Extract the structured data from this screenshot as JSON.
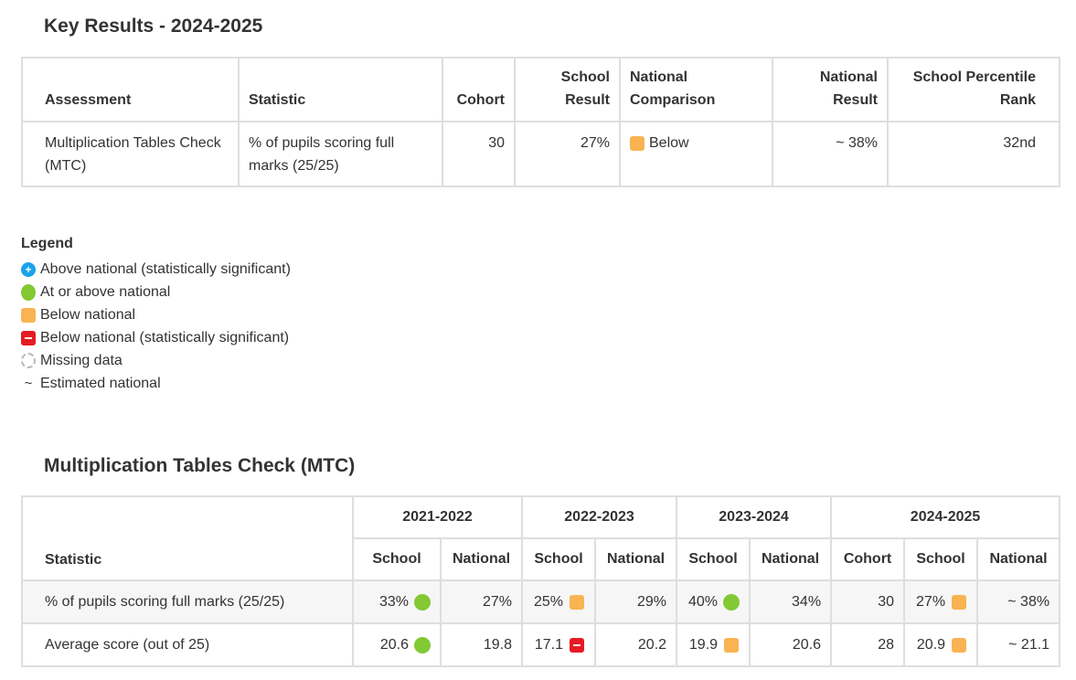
{
  "key_results": {
    "title": "Key Results - 2024-2025",
    "headers": {
      "assessment": "Assessment",
      "statistic": "Statistic",
      "cohort": "Cohort",
      "school_result": "School Result",
      "national_comparison": "National Comparison",
      "national_result": "National Result",
      "percentile_rank": "School Percentile Rank"
    },
    "row": {
      "assessment": "Multiplication Tables Check (MTC)",
      "statistic": "% of pupils scoring full marks (25/25)",
      "cohort": "30",
      "school_result": "27%",
      "comparison_icon": "amber-square-icon",
      "comparison_label": "Below",
      "national_result": "~ 38%",
      "percentile_rank": "32nd"
    }
  },
  "legend": {
    "title": "Legend",
    "items": [
      {
        "icon": "plus-circle-icon",
        "label": "Above national (statistically significant)"
      },
      {
        "icon": "green-circle-icon",
        "label": "At or above national"
      },
      {
        "icon": "amber-square-icon",
        "label": "Below national"
      },
      {
        "icon": "red-minus-square-icon",
        "label": "Below national (statistically significant)"
      },
      {
        "icon": "missing-circle-icon",
        "label": "Missing data"
      },
      {
        "icon": "tilde",
        "symbol": "~",
        "label": "Estimated national"
      }
    ]
  },
  "mtc": {
    "title": "Multiplication Tables Check (MTC)",
    "statistic_header": "Statistic",
    "years": [
      "2021-2022",
      "2022-2023",
      "2023-2024",
      "2024-2025"
    ],
    "sub_headers": {
      "school": "School",
      "national": "National",
      "cohort": "Cohort"
    },
    "rows": [
      {
        "label": "% of pupils scoring full marks (25/25)",
        "y2122_school": "33%",
        "y2122_icon": "green-circle-icon",
        "y2122_national": "27%",
        "y2223_school": "25%",
        "y2223_icon": "amber-square-icon",
        "y2223_national": "29%",
        "y2324_school": "40%",
        "y2324_icon": "green-circle-icon",
        "y2324_national": "34%",
        "y2425_cohort": "30",
        "y2425_school": "27%",
        "y2425_icon": "amber-square-icon",
        "y2425_national": "~ 38%"
      },
      {
        "label": "Average score (out of 25)",
        "y2122_school": "20.6",
        "y2122_icon": "green-circle-icon",
        "y2122_national": "19.8",
        "y2223_school": "17.1",
        "y2223_icon": "red-minus-square-icon",
        "y2223_national": "20.2",
        "y2324_school": "19.9",
        "y2324_icon": "amber-square-icon",
        "y2324_national": "20.6",
        "y2425_cohort": "28",
        "y2425_school": "20.9",
        "y2425_icon": "amber-square-icon",
        "y2425_national": "~ 21.1"
      }
    ]
  },
  "colors": {
    "green": "#82c934",
    "amber": "#f9b352",
    "red": "#e51b24",
    "blue": "#1aa3e8",
    "border": "#dedede"
  }
}
